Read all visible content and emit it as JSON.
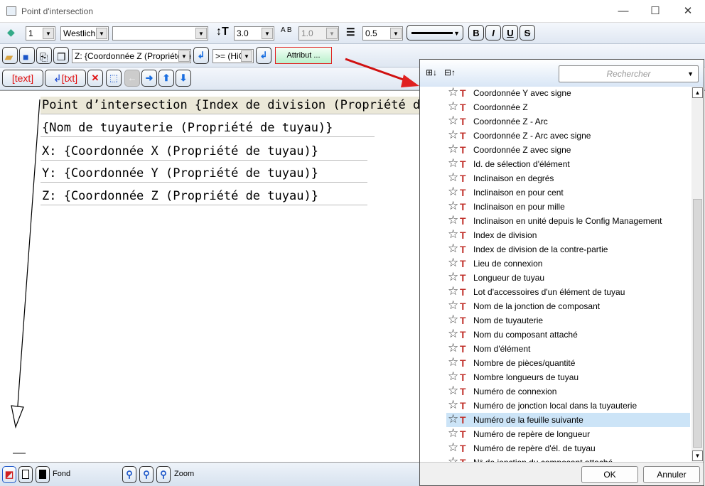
{
  "window": {
    "title": "Point d'intersection",
    "minimize": "—",
    "maximize": "☐",
    "close": "✕"
  },
  "toolbar1": {
    "layer": "1",
    "font": "Westlich",
    "style": "",
    "height": "3.0",
    "width": "1.0",
    "spacing": "0.5",
    "bold": "B",
    "italic": "I",
    "underline": "U",
    "strike": "S"
  },
  "toolbar2": {
    "attribute_combo": "Z: {Coordonnée Z (Propriété de tuyau)}",
    "operator_combo": ">= (HiC",
    "attribut_button": "Attribut ..."
  },
  "toolbar3": {
    "text_button": "text",
    "txt_button": "txt"
  },
  "editor": {
    "lines": [
      "Point d’intersection {Index de division (Propriété de tuyau)}",
      "{Nom de tuyauterie (Propriété de tuyau)}",
      "X: {Coordonnée X (Propriété de tuyau)}",
      "Y: {Coordonnée Y (Propriété de tuyau)}",
      "Z: {Coordonnée Z (Propriété de tuyau)}"
    ]
  },
  "bottom": {
    "fond_label": "Fond",
    "zoom_label": "Zoom"
  },
  "panel": {
    "search_placeholder": "Rechercher",
    "ok": "OK",
    "cancel": "Annuler",
    "items": [
      "Coordonnée Y avec signe",
      "Coordonnée Z",
      "Coordonnée Z - Arc",
      "Coordonnée Z - Arc avec signe",
      "Coordonnée Z avec signe",
      "Id. de sélection d'élément",
      "Inclinaison en degrés",
      "Inclinaison en pour cent",
      "Inclinaison en pour mille",
      "Inclinaison en unité depuis le Config Management",
      "Index de division",
      "Index de division de la contre-partie",
      "Lieu de connexion",
      "Longueur de tuyau",
      "Lot d'accessoires d'un élément de tuyau",
      "Nom de la jonction de composant",
      "Nom de tuyauterie",
      "Nom du composant attaché",
      "Nom d'élément",
      "Nombre de pièces/quantité",
      "Nombre longueurs de tuyau",
      "Numéro de connexion",
      "Numéro de jonction local dans la tuyauterie",
      "Numéro de la feuille suivante",
      "Numéro de repère de longueur",
      "Numéro de repère d'él. de tuyau",
      "N° de jonction du composant attaché"
    ],
    "selected_index": 23
  }
}
